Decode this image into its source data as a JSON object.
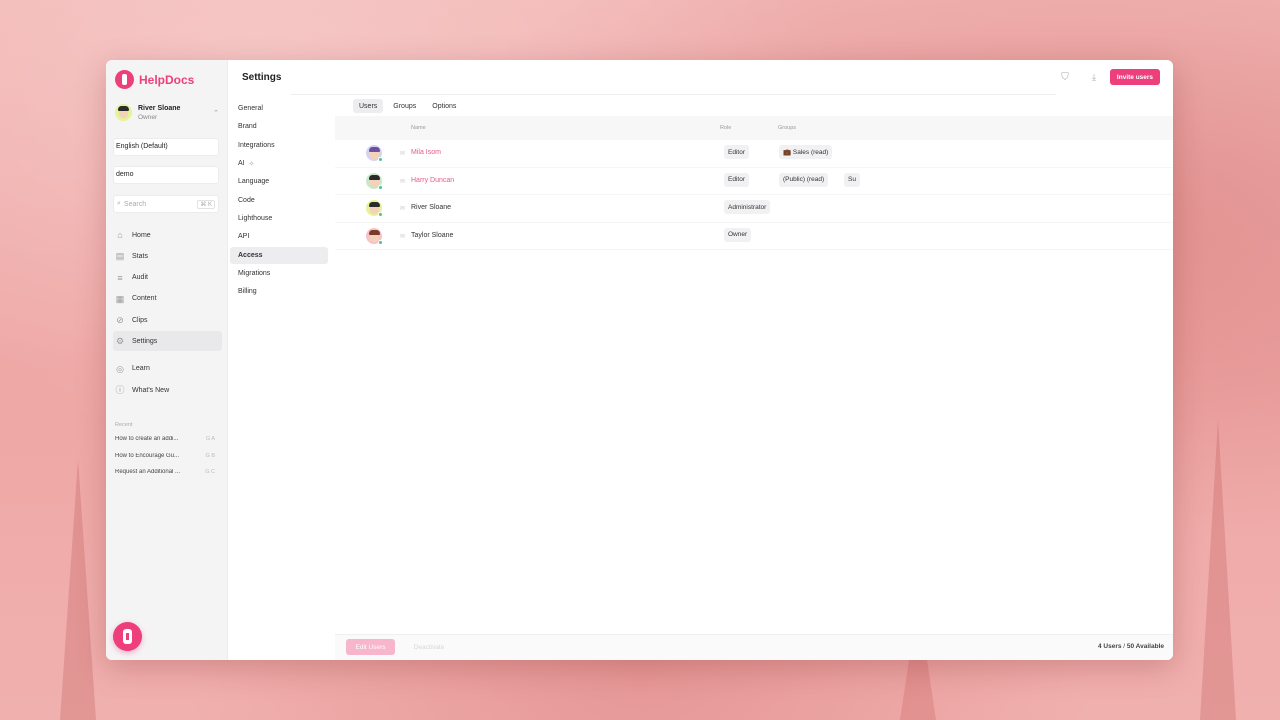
{
  "app": {
    "name": "HelpDocs"
  },
  "user": {
    "name": "River Sloane",
    "role": "Owner"
  },
  "language_select": "English (Default)",
  "site_select": "demo",
  "search": {
    "placeholder": "Search",
    "shortcut": "⌘ K"
  },
  "nav": [
    {
      "label": "Home",
      "icon": "home-icon"
    },
    {
      "label": "Stats",
      "icon": "stats-icon"
    },
    {
      "label": "Audit",
      "icon": "audit-icon"
    },
    {
      "label": "Content",
      "icon": "content-icon"
    },
    {
      "label": "Clips",
      "icon": "clip-icon"
    },
    {
      "label": "Settings",
      "icon": "gear-icon",
      "active": true
    },
    {
      "label": "Learn",
      "icon": "learn-icon"
    },
    {
      "label": "What's New",
      "icon": "info-icon"
    }
  ],
  "recent": {
    "title": "Recent",
    "items": [
      {
        "title": "How to create an addi...",
        "key": "G A"
      },
      {
        "title": "How to Encourage Gu...",
        "key": "G B"
      },
      {
        "title": "Request an Additional ...",
        "key": "G C"
      }
    ]
  },
  "settings": {
    "title": "Settings",
    "menu": [
      "General",
      "Brand",
      "Integrations",
      "AI",
      "Language",
      "Code",
      "Lighthouse",
      "API",
      "Access",
      "Migrations",
      "Billing"
    ],
    "active": "Access"
  },
  "toolbar": {
    "invite_label": "Invite users"
  },
  "tabs": [
    {
      "label": "Users",
      "active": true
    },
    {
      "label": "Groups"
    },
    {
      "label": "Options"
    }
  ],
  "table": {
    "headers": {
      "name": "Name",
      "role": "Role",
      "groups": "Groups"
    },
    "rows": [
      {
        "name": "Mila Isom",
        "pending": true,
        "role": "Editor",
        "groups": [
          "💼 Sales (read)"
        ]
      },
      {
        "name": "Harry Duncan",
        "pending": true,
        "role": "Editor",
        "groups": [
          "(Public) (read)",
          "Su"
        ]
      },
      {
        "name": "River Sloane",
        "pending": false,
        "role": "Administrator",
        "groups": []
      },
      {
        "name": "Taylor Sloane",
        "pending": false,
        "role": "Owner",
        "groups": []
      }
    ]
  },
  "footer": {
    "edit_label": "Edit Users",
    "deactivate_label": "Deactivate",
    "count_used": "4 Users",
    "count_sep": " / ",
    "count_avail": "50 Available"
  },
  "colors": {
    "accent": "#ec3f7c",
    "background": "#f0b0ae"
  }
}
